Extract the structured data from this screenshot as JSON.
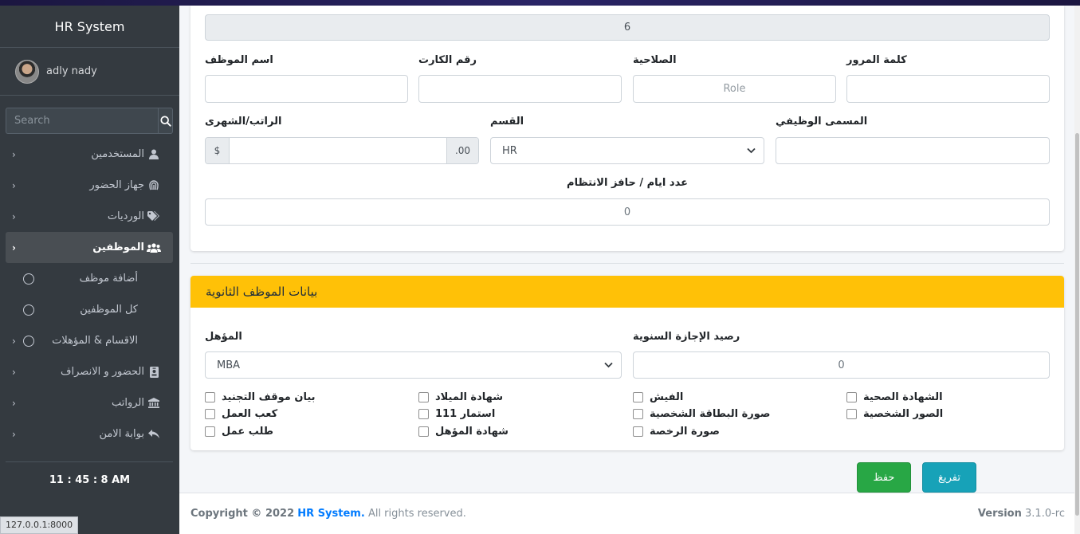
{
  "sidebar": {
    "brand": "HR System",
    "user_name": "adly nady",
    "search_placeholder": "Search",
    "items": [
      {
        "label": "المستخدمين",
        "icon": "user-icon"
      },
      {
        "label": "جهاز الحضور",
        "icon": "fingerprint-icon"
      },
      {
        "label": "الورديات",
        "icon": "tags-icon"
      },
      {
        "label": "الموظفين",
        "icon": "users-icon"
      },
      {
        "label": "الحضور و الانصراف",
        "icon": "id-badge-icon"
      },
      {
        "label": "الرواتب",
        "icon": "bank-icon"
      },
      {
        "label": "بوابة الامن",
        "icon": "reply-icon"
      }
    ],
    "sub_items": [
      {
        "label": "أضافة موظف"
      },
      {
        "label": "كل الموظفين"
      },
      {
        "label": "الاقسام & المؤهلات"
      }
    ],
    "clock": "11 : 45 : 8 AM"
  },
  "status_url": "127.0.0.1:8000",
  "form": {
    "id_value": "6",
    "labels": {
      "employee_name": "اسم الموظف",
      "card_number": "رقم الكارت",
      "role": "الصلاحية",
      "password": "كلمة المرور",
      "salary": "الراتب/الشهرى",
      "department": "القسم",
      "job_title": "المسمى الوظيفي",
      "attendance_days": "عدد ايام / حافز الانتظام"
    },
    "role_placeholder": "Role",
    "currency_symbol": "$",
    "decimal_suffix": ".00",
    "department_value": "HR",
    "attendance_days_value": "0"
  },
  "secondary": {
    "title": "بيانات الموظف الثانوية",
    "qualification_label": "المؤهل",
    "qualification_value": "MBA",
    "annual_leave_label": "رصيد الإجازة السنوية",
    "annual_leave_value": "0",
    "checkboxes": [
      [
        "الشهادة الصحية",
        "الفيش",
        "شهادة الميلاد",
        "بيان موقف التجنيد"
      ],
      [
        "الصور الشخصية",
        "صورة البطاقة الشخصية",
        "استمار 111",
        "كعب العمل"
      ],
      [
        "",
        "صورة الرخصة",
        "شهادة المؤهل",
        "طلب عمل"
      ]
    ]
  },
  "buttons": {
    "save": "حفظ",
    "clear": "تفريغ"
  },
  "footer": {
    "copyright_prefix": "Copyright © 2022",
    "brand_link": "HR System.",
    "rights": "All rights reserved.",
    "version_label": "Version",
    "version_value": "3.1.0-rc"
  }
}
